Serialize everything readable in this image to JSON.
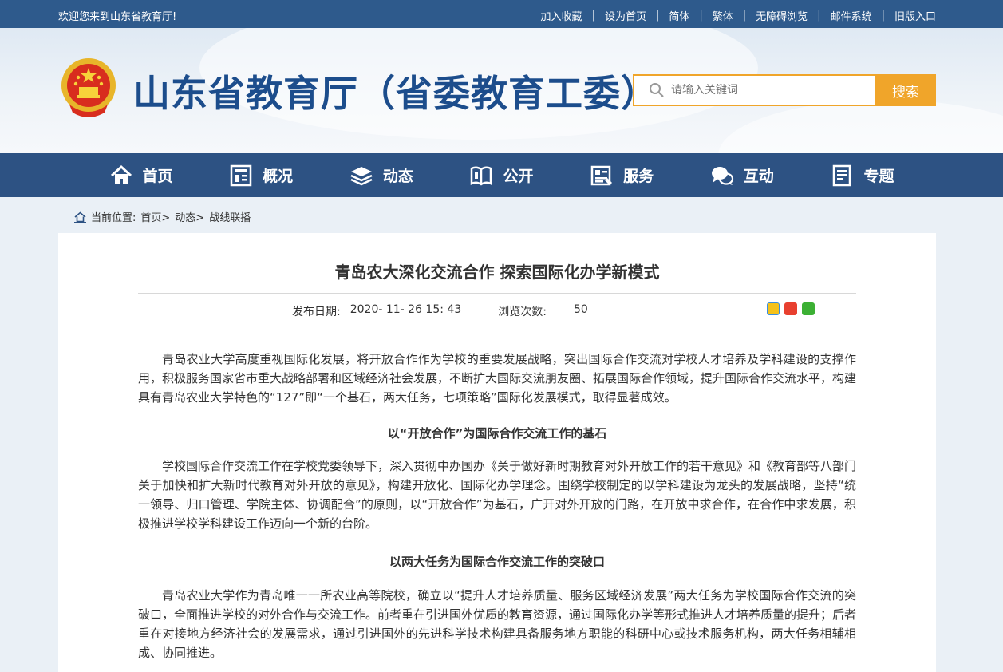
{
  "topbar": {
    "welcome": "欢迎您来到山东省教育厅!",
    "links": [
      "加入收藏",
      "设为首页",
      "简体",
      "繁体",
      "无障碍浏览",
      "邮件系统",
      "旧版入口"
    ]
  },
  "header": {
    "title": "山东省教育厅（省委教育工委）",
    "search_placeholder": "请输入关键词",
    "search_button": "搜索"
  },
  "nav": [
    {
      "label": "首页",
      "icon": "home-icon"
    },
    {
      "label": "概况",
      "icon": "overview-icon"
    },
    {
      "label": "动态",
      "icon": "layers-icon"
    },
    {
      "label": "公开",
      "icon": "book-icon"
    },
    {
      "label": "服务",
      "icon": "service-icon"
    },
    {
      "label": "互动",
      "icon": "chat-icon"
    },
    {
      "label": "专题",
      "icon": "document-icon"
    }
  ],
  "breadcrumb": {
    "prefix": "当前位置:",
    "items": [
      "首页>",
      "动态>",
      "战线联播"
    ]
  },
  "article": {
    "title": "青岛农大深化交流合作 探索国际化办学新模式",
    "date_label": "发布日期:",
    "date": "2020- 11- 26 15: 43",
    "views_label": "浏览次数:",
    "views": "50",
    "p1": "青岛农业大学高度重视国际化发展，将开放合作作为学校的重要发展战略，突出国际合作交流对学校人才培养及学科建设的支撑作用，积极服务国家省市重大战略部署和区域经济社会发展，不断扩大国际交流朋友圈、拓展国际合作领域，提升国际合作交流水平，构建具有青岛农业大学特色的“127”即“一个基石，两大任务，七项策略”国际化发展模式，取得显著成效。",
    "h1": "以“开放合作”为国际合作交流工作的基石",
    "p2": "学校国际合作交流工作在学校党委领导下，深入贯彻中办国办《关于做好新时期教育对外开放工作的若干意见》和《教育部等八部门关于加快和扩大新时代教育对外开放的意见》，构建开放化、国际化办学理念。围绕学校制定的以学科建设为龙头的发展战略，坚持“统一领导、归口管理、学院主体、协调配合”的原则，以“开放合作”为基石，广开对外开放的门路，在开放中求合作，在合作中求发展，积极推进学校学科建设工作迈向一个新的台阶。",
    "h2": "以两大任务为国际合作交流工作的突破口",
    "p3": "青岛农业大学作为青岛唯一一所农业高等院校，确立以“提升人才培养质量、服务区域经济发展”两大任务为学校国际合作交流的突破口，全面推进学校的对外合作与交流工作。前者重在引进国外优质的教育资源，通过国际化办学等形式推进人才培养质量的提升；后者重在对接地方经济社会的发展需求，通过引进国外的先进科学技术构建具备服务地方职能的科研中心或技术服务机构，两大任务相辅相成、协同推进。"
  },
  "colors": {
    "topbar": "#2e5a8c",
    "nav": "#2d5283",
    "accent": "#f0a52a",
    "title": "#1c4d8c"
  }
}
